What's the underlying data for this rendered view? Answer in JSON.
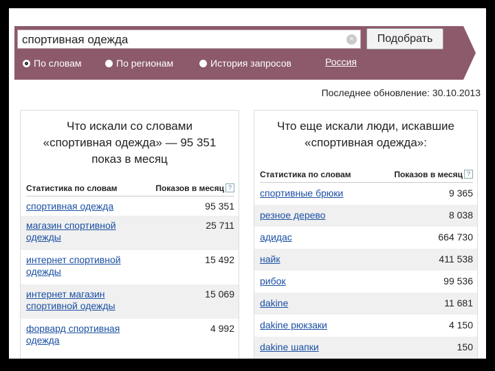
{
  "search": {
    "query": "спортивная одежда",
    "clear_glyph": "×",
    "submit_label": "Подобрать",
    "modes": [
      "По словам",
      "По регионам",
      "История запросов"
    ],
    "region": "Россия"
  },
  "last_update": "Последнее обновление: 30.10.2013",
  "left": {
    "title_lines": [
      "Что искали со словами",
      "«спортивная одежда» — 95 351",
      "показ в месяц"
    ],
    "col_stats": "Статистика по словам",
    "col_count": "Показов в месяц",
    "help_glyph": "?",
    "rows": [
      {
        "lines": [
          "спортивная одежда"
        ],
        "count": "95 351"
      },
      {
        "lines": [
          "магазин спортивной",
          "одежды"
        ],
        "count": "25 711"
      },
      {
        "lines": [
          "интернет спортивной",
          "одежды"
        ],
        "count": "15 492"
      },
      {
        "lines": [
          "интернет магазин",
          "спортивной одежды"
        ],
        "count": "15 069"
      },
      {
        "lines": [
          "форвард спортивная",
          "одежда"
        ],
        "count": "4 992"
      }
    ]
  },
  "right": {
    "title_lines": [
      "Что еще искали люди, искавшие",
      "«спортивная одежда»:"
    ],
    "col_stats": "Статистика по словам",
    "col_count": "Показов в месяц",
    "help_glyph": "?",
    "rows": [
      {
        "lines": [
          "спортивные брюки"
        ],
        "count": "9 365"
      },
      {
        "lines": [
          "резное дерево"
        ],
        "count": "8 038"
      },
      {
        "lines": [
          "адидас"
        ],
        "count": "664 730"
      },
      {
        "lines": [
          "найк"
        ],
        "count": "411 538"
      },
      {
        "lines": [
          "рибок"
        ],
        "count": "99 536"
      },
      {
        "lines": [
          "dakine"
        ],
        "count": "11 681"
      },
      {
        "lines": [
          "dakine рюкзаки"
        ],
        "count": "4 150"
      },
      {
        "lines": [
          "dakine шапки"
        ],
        "count": "150"
      }
    ]
  },
  "colors": {
    "band": "#8c5a6a",
    "link": "#1a4fa3",
    "row_alt": "#f0f0f0"
  }
}
